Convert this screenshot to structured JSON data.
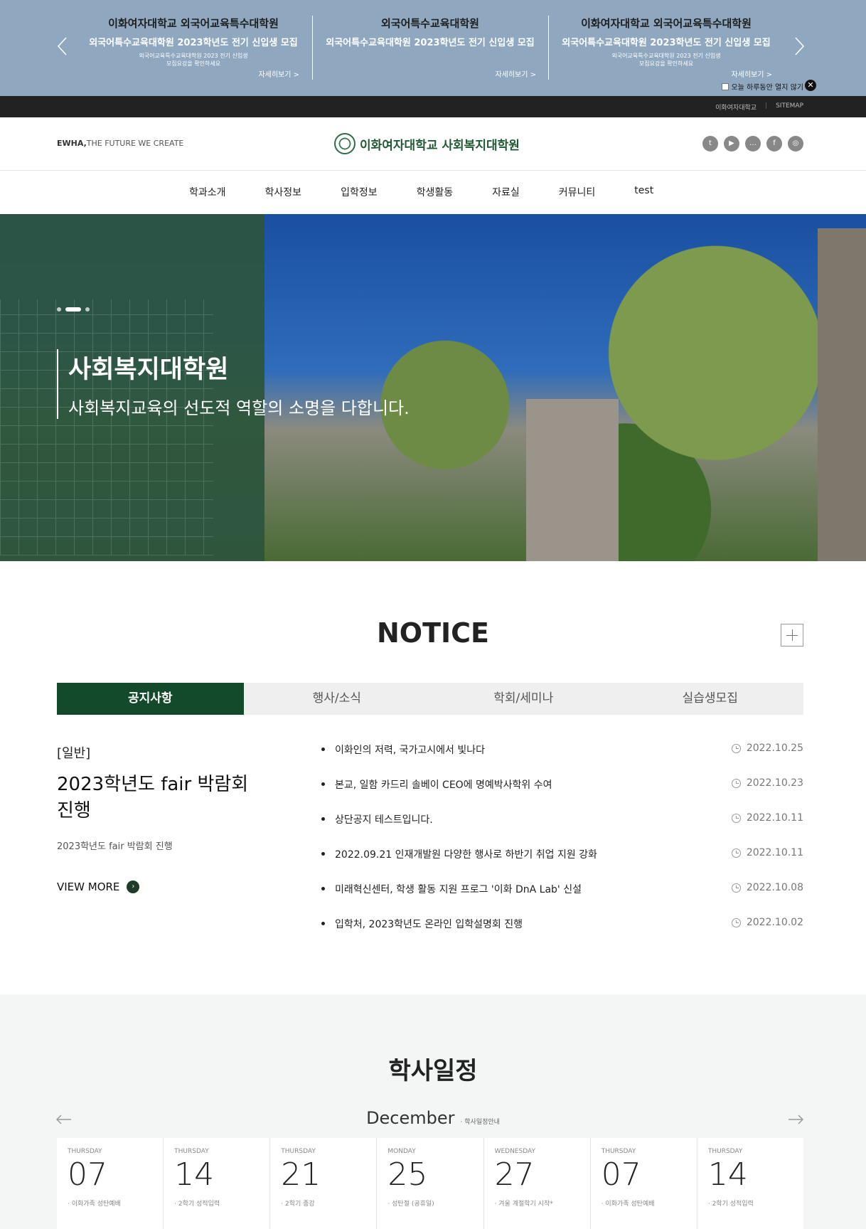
{
  "promo": {
    "items": [
      {
        "title": "이화여자대학교 외국어교육특수대학원",
        "subtitle": "외국어특수교육대학원 2023학년도 전기 신입생 모집",
        "desc": "외국어교육특수교육대학원 2023 전기 신입생 모집요강을 확인하세요",
        "more": "자세히보기  >"
      },
      {
        "title": "외국어특수교육대학원",
        "subtitle": "외국어특수교육대학원 2023학년도 전기 신입생 모집",
        "desc": "",
        "more": "자세히보기  >"
      },
      {
        "title": "이화여자대학교 외국어교육특수대학원",
        "subtitle": "외국어특수교육대학원 2023학년도 전기 신입생 모집",
        "desc": "외국어교육특수교육대학원 2023 전기 신입생 모집요강을 확인하세요",
        "more": "자세히보기  >"
      }
    ],
    "close_label": "오늘 하루동안 열지 않기",
    "close_icon": "✕"
  },
  "util": {
    "link1": "이화여자대학교",
    "sep": "|",
    "link2": "SITEMAP"
  },
  "header": {
    "slogan_bold": "EWHA,",
    "slogan": "THE FUTURE WE CREATE",
    "logo_name": "이화여자대학교 사회복지대학원",
    "sns": [
      "t",
      "▶",
      "…",
      "f",
      "◎"
    ]
  },
  "gnb": [
    "학과소개",
    "학사정보",
    "입학정보",
    "학생활동",
    "자료실",
    "커뮤니티",
    "test"
  ],
  "hero": {
    "title": "사회복지대학원",
    "subtitle": "사회복지교육의 선도적 역할의 소명을 다합니다."
  },
  "notice": {
    "title": "NOTICE",
    "tabs": [
      "공지사항",
      "행사/소식",
      "학회/세미나",
      "실습생모집"
    ],
    "feature": {
      "category": "[일반]",
      "title": "2023학년도 fair 박람회 진행",
      "desc": "2023학년도 fair 박람회 진행",
      "more": "VIEW MORE",
      "more_icon": "›"
    },
    "items": [
      {
        "text": "이화인의 저력, 국가고시에서 빛나다",
        "date": "2022.10.25"
      },
      {
        "text": "본교, 일함 카드리 솔베이 CEO에 명예박사학위 수여",
        "date": "2022.10.23"
      },
      {
        "text": "상단공지 테스트입니다.",
        "date": "2022.10.11"
      },
      {
        "text": "2022.09.21 인재개발원 다양한 행사로 하반기 취업 지원 강화",
        "date": "2022.10.11"
      },
      {
        "text": "미래혁신센터, 학생 활동 지원 프로그 '이화 DnA Lab' 신설",
        "date": "2022.10.08"
      },
      {
        "text": "입학처, 2023학년도 온라인 입학설명회 진행",
        "date": "2022.10.02"
      }
    ]
  },
  "schedule": {
    "title": "학사일정",
    "month": "December",
    "month_note": "· 학사일정안내",
    "cards": [
      {
        "dow": "THURSDAY",
        "day": "07",
        "event": "· 이화가족 성탄예배"
      },
      {
        "dow": "THURSDAY",
        "day": "14",
        "event": "· 2학기 성적입력"
      },
      {
        "dow": "THURSDAY",
        "day": "21",
        "event": "· 2학기 종강"
      },
      {
        "dow": "MONDAY",
        "day": "25",
        "event": "· 성탄절 (공휴일)"
      },
      {
        "dow": "WEDNESDAY",
        "day": "27",
        "event": "· 겨울 계절학기 시작*"
      },
      {
        "dow": "THURSDAY",
        "day": "07",
        "event": "· 이화가족 성탄예배"
      },
      {
        "dow": "THURSDAY",
        "day": "14",
        "event": "· 2학기 성적입력"
      }
    ]
  }
}
